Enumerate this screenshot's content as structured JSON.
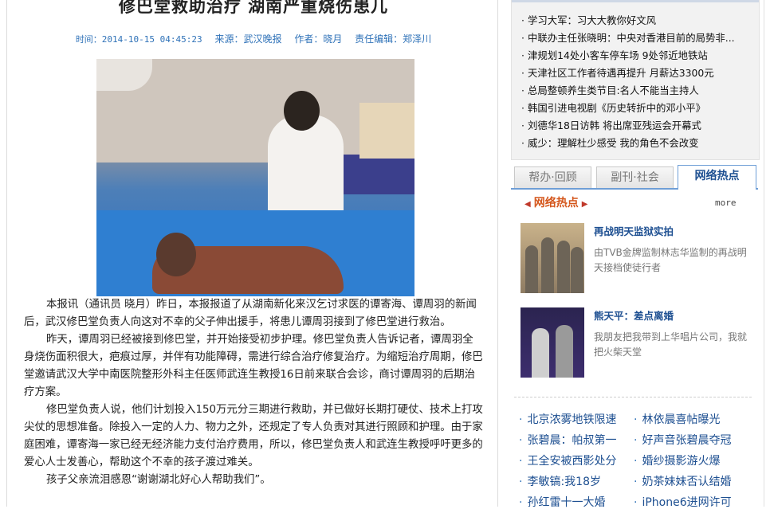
{
  "article": {
    "headline": "修巴堂救助治疗  湖南严重烧伤患儿",
    "meta": {
      "time": "时间：2014-10-15 04:45:23",
      "source": "来源：武汉晚报",
      "author": "作者：晓月",
      "editor": "责任编辑：郑泽川"
    },
    "paragraphs": [
      "本报讯（通讯员  晓月）昨日，本报报道了从湖南新化来汉乞讨求医的谭寄海、谭周羽的新闻后，武汉修巴堂负责人向这对不幸的父子伸出援手，将患儿谭周羽接到了修巴堂进行救治。",
      "昨天，谭周羽已经被接到修巴堂，并开始接受初步护理。修巴堂负责人告诉记者，谭周羽全身烧伤面积很大，疤痕过厚，并伴有功能障碍，需进行综合治疗修复治疗。为缩短治疗周期，修巴堂邀请武汉大学中南医院整形外科主任医师武连生教授16日前来联合会诊，商讨谭周羽的后期治疗方案。",
      "修巴堂负责人说，他们计划投入150万元分三期进行救助，并已做好长期打硬仗、技术上打攻尖仗的思想准备。除投入一定的人力、物力之外，还规定了专人负责对其进行照顾和护理。由于家庭困难，谭寄海一家已经无经济能力支付治疗费用，所以，修巴堂负责人和武连生教授呼吁更多的爱心人士发善心，帮助这个不幸的孩子渡过难关。",
      "孩子父亲流泪感恩“谢谢湖北好心人帮助我们”。"
    ]
  },
  "sidebar": {
    "top_news": [
      "学习大军：习大大教你好文风",
      "中联办主任张晓明：中央对香港目前的局势非...",
      "津规划14处小客车停车场 9处邻近地铁站",
      "天津社区工作者待遇再提升 月薪达3300元",
      "总局整顿养生类节目:名人不能当主持人",
      "韩国引进电视剧《历史转折中的邓小平》",
      "刘德华18日访韩 将出席亚残运会开幕式",
      "威少：理解杜少感受 我的角色不会改变"
    ],
    "tabs": [
      "帮办·回顾",
      "副刊·社会",
      "网络热点"
    ],
    "section_title": "网络热点",
    "more": "more",
    "features": [
      {
        "title": "再战明天监狱实拍",
        "desc": "由TVB金牌监制林志华监制的再战明天接档使徒行者"
      },
      {
        "title": "熊天平：差点离婚",
        "desc": "我朋友把我带到上华唱片公司，我就把火柴天堂"
      }
    ],
    "hot_left": [
      "北京浓雾地铁限速",
      "张碧晨：帕叔第一",
      "王全安被西影处分",
      "李敏镐:我18岁",
      "孙红雷十一大婚"
    ],
    "hot_right": [
      "林依晨喜帖曝光",
      "好声音张碧晨夺冠",
      "婚纱摄影游火爆",
      "奶茶妹妹否认结婚",
      "iPhone6进网许可"
    ]
  }
}
